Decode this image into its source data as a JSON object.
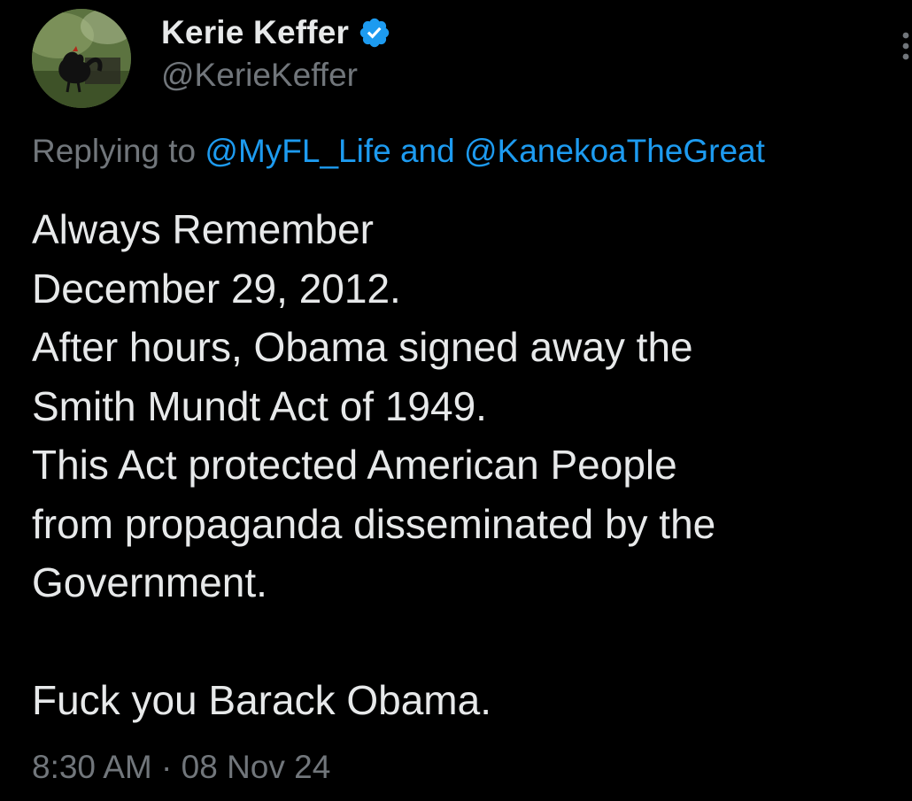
{
  "author": {
    "name": "Kerie Keffer",
    "handle": "@KerieKeffer",
    "verified": true,
    "verified_color": "#1d9bf0",
    "avatar_icon": "rooster-photo-avatar"
  },
  "reply": {
    "prefix": "Replying to ",
    "mention_1": "@MyFL_Life",
    "joiner": " and ",
    "mention_2": "@KanekoaTheGreat",
    "mention_color": "#1d9bf0"
  },
  "tweet": {
    "lines": [
      "Always Remember",
      "December 29, 2012.",
      "After hours, Obama signed away the",
      "Smith Mundt Act of 1949.",
      "This Act protected American People",
      "from propaganda disseminated by the",
      "Government.",
      "",
      "Fuck you Barack Obama."
    ]
  },
  "meta": {
    "time": "8:30 AM",
    "separator": " · ",
    "date": "08 Nov 24"
  },
  "colors": {
    "background": "#000000",
    "primary_text": "#e7e9ea",
    "secondary_text": "#71767b",
    "accent": "#1d9bf0"
  }
}
